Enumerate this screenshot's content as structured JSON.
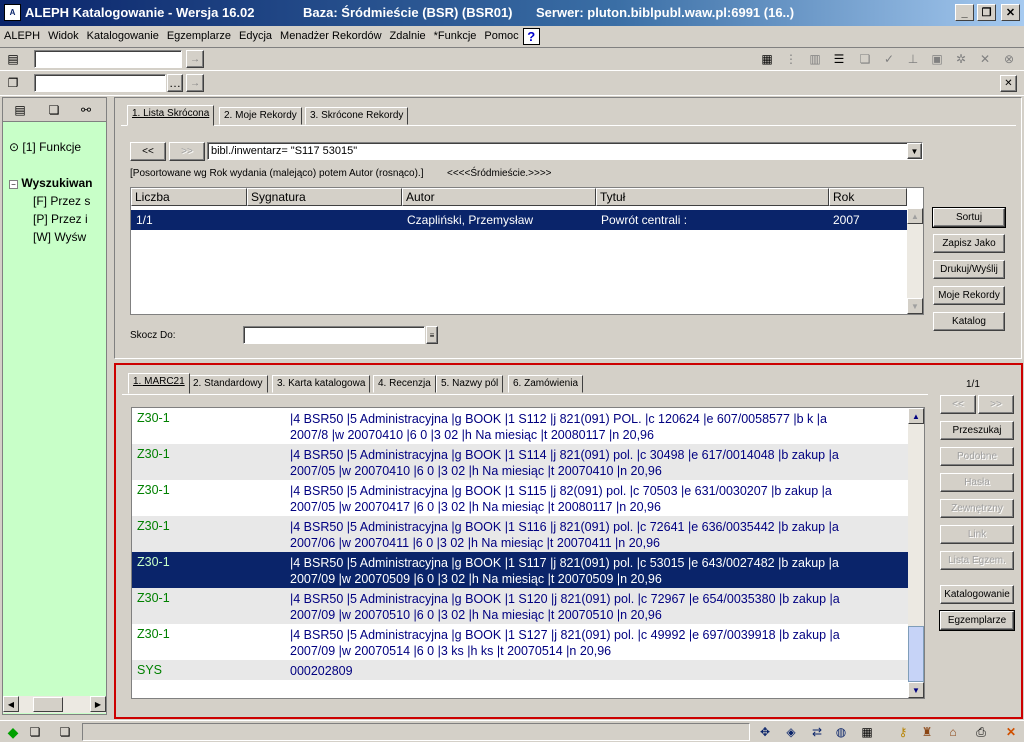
{
  "titlebar": {
    "app": "ALEPH Katalogowanie - Wersja 16.02",
    "base": "Baza:  Śródmieście (BSR) (BSR01)",
    "server": "Serwer:  pluton.biblpubl.waw.pl:6991 (16..)"
  },
  "menu": [
    "ALEPH",
    "Widok",
    "Katalogowanie",
    "Egzemplarze",
    "Edycja",
    "Menadżer Rekordów",
    "Zdalnie",
    "*Funkcje",
    "Pomoc"
  ],
  "help_icon": "?",
  "left_panel": {
    "funkcje": "[1] Funkcje",
    "tree_root": "Wyszukiwan",
    "tree_items": [
      "[F] Przez s",
      "[P] Przez i",
      "[W] Wyśw"
    ]
  },
  "upper": {
    "tabs": [
      "1. Lista Skrócona",
      "2. Moje Rekordy",
      "3. Skrócone Rekordy"
    ],
    "nav_prev": "<<",
    "nav_next": ">>",
    "query": "bibl./inwentarz= \"S117 53015\"",
    "sort_info": "[Posortowane wg Rok wydania (malejąco) potem Autor (rosnąco).]",
    "location": "<<<<Śródmieście.>>>>",
    "columns": [
      "Liczba",
      "Sygnatura",
      "Autor",
      "Tytuł",
      "Rok"
    ],
    "rows": [
      {
        "liczba": "1/1",
        "sygnatura": "",
        "autor": "Czapliński, Przemysław",
        "tytul": "Powrót centrali :",
        "rok": "2007"
      }
    ],
    "skocz_label": "Skocz Do:",
    "buttons": [
      "Sortuj",
      "Zapisz Jako",
      "Drukuj/Wyślij",
      "Moje Rekordy",
      "Katalog"
    ]
  },
  "lower": {
    "tabs": [
      "1. MARC21",
      "2. Standardowy",
      "3. Karta katalogowa",
      "4. Recenzja",
      "5. Nazwy pól",
      "6. Zamówienia"
    ],
    "counter": "1/1",
    "nav_prev": "<<",
    "nav_next": ">>",
    "rows": [
      {
        "tag": "Z30-1",
        "line1": "|4 BSR50 |5 Administracyjna |g BOOK |1 S112 |j 821(091)  POL. |c 120624 |e 607/0058577 |b k |a",
        "line2": "2007/8 |w 20070410 |6 0 |3 02 |h Na miesiąc |t 20080117 |n 20,96"
      },
      {
        "tag": "Z30-1",
        "line1": "|4 BSR50 |5 Administracyjna |g BOOK |1 S114 |j 821(091) pol. |c 30498 |e 617/0014048 |b zakup |a",
        "line2": "2007/05 |w 20070410 |6 0 |3 02 |h Na miesiąc |t 20070410 |n 20,96"
      },
      {
        "tag": "Z30-1",
        "line1": "|4 BSR50 |5 Administracyjna |g BOOK |1 S115 |j 82(091) pol. |c 70503 |e 631/0030207 |b zakup |a",
        "line2": "2007/05 |w 20070417 |6 0 |3 02 |h Na miesiąc |t 20080117 |n 20,96"
      },
      {
        "tag": "Z30-1",
        "line1": "|4 BSR50 |5 Administracyjna |g BOOK |1 S116 |j 821(091) pol. |c 72641 |e 636/0035442 |b zakup |a",
        "line2": "2007/06 |w 20070411 |6 0 |3 02 |h Na miesiąc |t 20070411 |n 20,96"
      },
      {
        "tag": "Z30-1",
        "line1": "|4 BSR50 |5 Administracyjna |g BOOK |1 S117 |j 821(091) pol. |c 53015 |e 643/0027482 |b zakup |a",
        "line2": "2007/09 |w 20070509 |6 0 |3 02 |h Na miesiąc |t 20070509 |n 20,96"
      },
      {
        "tag": "Z30-1",
        "line1": "|4 BSR50 |5 Administracyjna |g BOOK |1 S120 |j 821(091) pol. |c 72967 |e 654/0035380 |b zakup |a",
        "line2": "2007/09 |w 20070510 |6 0 |3 02 |h Na miesiąc |t 20070510 |n 20,96"
      },
      {
        "tag": "Z30-1",
        "line1": "|4 BSR50 |5 Administracyjna |g BOOK |1 S127 |j 821(091) pol. |c 49992 |e 697/0039918 |b zakup |a",
        "line2": "2007/09 |w 20070514 |6 0 |3 ks |h ks |t 20070514 |n 20,96"
      },
      {
        "tag": "SYS",
        "line1": "000202809",
        "line2": ""
      }
    ],
    "buttons": [
      {
        "label": "Przeszukaj",
        "enabled": true
      },
      {
        "label": "Podobne",
        "enabled": false
      },
      {
        "label": "Hasła",
        "enabled": false
      },
      {
        "label": "Zewnętrzny",
        "enabled": false
      },
      {
        "label": "Link",
        "enabled": false
      },
      {
        "label": "Lista Egzem.",
        "enabled": false
      },
      {
        "label": "Katalogowanie",
        "enabled": true
      },
      {
        "label": "Egzemplarze",
        "enabled": true
      }
    ]
  },
  "colors": {
    "selection": "#0a246a",
    "left_panel": "#c8ffc8",
    "tag": "#008000",
    "value": "#000080",
    "frame": "#cc0000"
  }
}
